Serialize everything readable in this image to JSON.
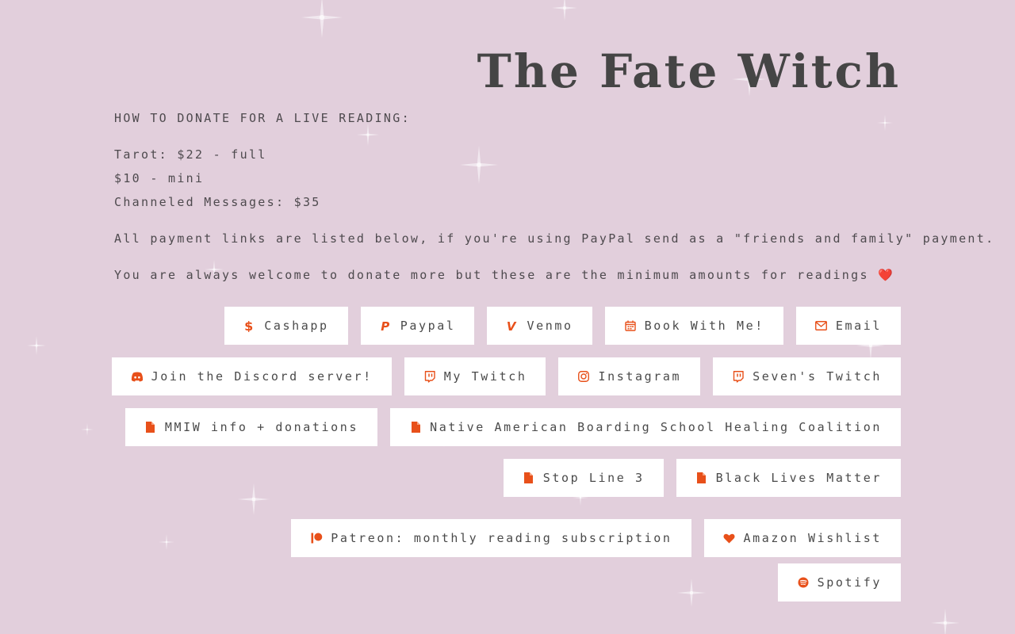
{
  "site": {
    "title": "The Fate Witch"
  },
  "description": {
    "heading": "HOW TO DONATE FOR A LIVE READING:",
    "tarot_full": "Tarot: $22 - full",
    "tarot_mini": "$10 - mini",
    "channeled": "Channeled Messages: $35",
    "payment_note": "All payment links are listed below, if you're using PayPal send as a \"friends and family\" payment.",
    "welcome_note": "You are always welcome to donate more but these are the minimum amounts for readings ❤️"
  },
  "links": {
    "cashapp": "Cashapp",
    "paypal": "Paypal",
    "venmo": "Venmo",
    "book": "Book With Me!",
    "email": "Email",
    "discord": "Join the Discord server!",
    "my_twitch": "My Twitch",
    "instagram": "Instagram",
    "sevens_twitch": "Seven's Twitch",
    "mmiw": "MMIW info + donations",
    "boarding_school": "Native American Boarding School Healing Coalition",
    "stop_line_3": "Stop Line 3",
    "blm": "Black Lives Matter",
    "patreon": "Patreon: monthly reading subscription",
    "amazon": "Amazon Wishlist",
    "spotify": "Spotify"
  },
  "icons": {
    "cashapp": "dollar-icon",
    "paypal": "paypal-icon",
    "venmo": "venmo-icon",
    "book": "calendar-icon",
    "email": "envelope-icon",
    "discord": "discord-icon",
    "twitch": "twitch-icon",
    "instagram": "instagram-icon",
    "file": "file-icon",
    "patreon": "patreon-icon",
    "heart": "heart-icon",
    "spotify": "spotify-icon"
  },
  "colors": {
    "background": "#e2cfdc",
    "icon_accent": "#e8501a",
    "button_bg": "#ffffff",
    "title": "#454545",
    "text": "#4a4a4a"
  }
}
